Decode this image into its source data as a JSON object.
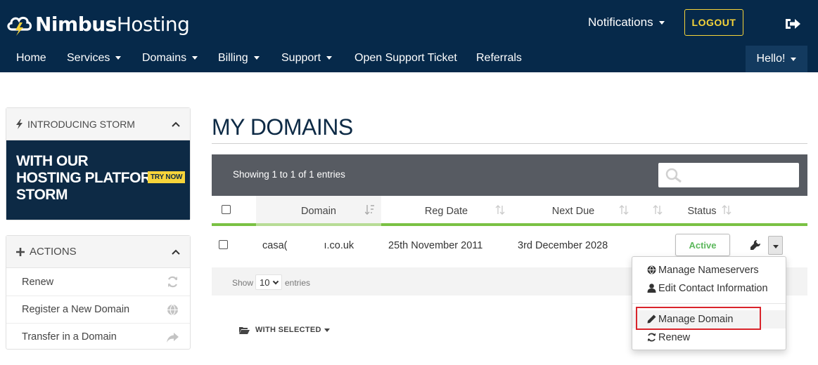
{
  "header": {
    "logo_bold": "Nimbus",
    "logo_light": "Hosting",
    "notifications_label": "Notifications",
    "logout_label": "LOGOUT",
    "exit_icon": "sign-out-icon"
  },
  "nav": {
    "items": [
      {
        "label": "Home"
      },
      {
        "label": "Services"
      },
      {
        "label": "Domains"
      },
      {
        "label": "Billing"
      },
      {
        "label": "Support"
      },
      {
        "label": "Open Support Ticket"
      },
      {
        "label": "Referrals"
      }
    ],
    "user_menu": "Hello!"
  },
  "sidebar": {
    "storm_panel": {
      "title": "INTRODUCING STORM",
      "banner_lines": [
        "WITH OUR",
        "HOSTING PLATFORM",
        "STORM"
      ],
      "try_now": "TRY NOW"
    },
    "actions_panel": {
      "title": "ACTIONS",
      "items": [
        {
          "label": "Renew",
          "icon": "refresh-icon"
        },
        {
          "label": "Register a New Domain",
          "icon": "globe-icon"
        },
        {
          "label": "Transfer in a Domain",
          "icon": "share-arrow-icon"
        }
      ]
    }
  },
  "main": {
    "title": "MY DOMAINS",
    "table": {
      "showing_text": "Showing 1 to 1 of 1 entries",
      "search_placeholder": "",
      "columns": [
        "Domain",
        "Reg Date",
        "Next Due",
        "Status"
      ],
      "rows": [
        {
          "domain": "casac[redacted]n.co.uk",
          "domain_left": "casa(",
          "domain_right": "ı.co.uk",
          "reg_date": "25th November 2011",
          "next_due": "3rd December 2028",
          "status": "Active"
        }
      ],
      "footer": {
        "show_label": "Show",
        "page_length": "10",
        "entries_label": "entries"
      }
    },
    "with_selected_label": "WITH SELECTED"
  },
  "dropdown_menu": {
    "items": [
      {
        "label": "Manage Nameservers",
        "icon": "globe-icon"
      },
      {
        "label": "Edit Contact Information",
        "icon": "user-icon"
      },
      {
        "label": "Manage Domain",
        "icon": "pencil-icon",
        "highlighted": true
      },
      {
        "label": "Renew",
        "icon": "refresh-icon"
      }
    ]
  },
  "colors": {
    "navy": "#06294a",
    "accent_yellow": "#f6d43a",
    "status_green": "#5cb85c",
    "table_header_bar": "#575b62",
    "highlight_red": "#d9242b",
    "column_underline_green": "#7ac143"
  }
}
